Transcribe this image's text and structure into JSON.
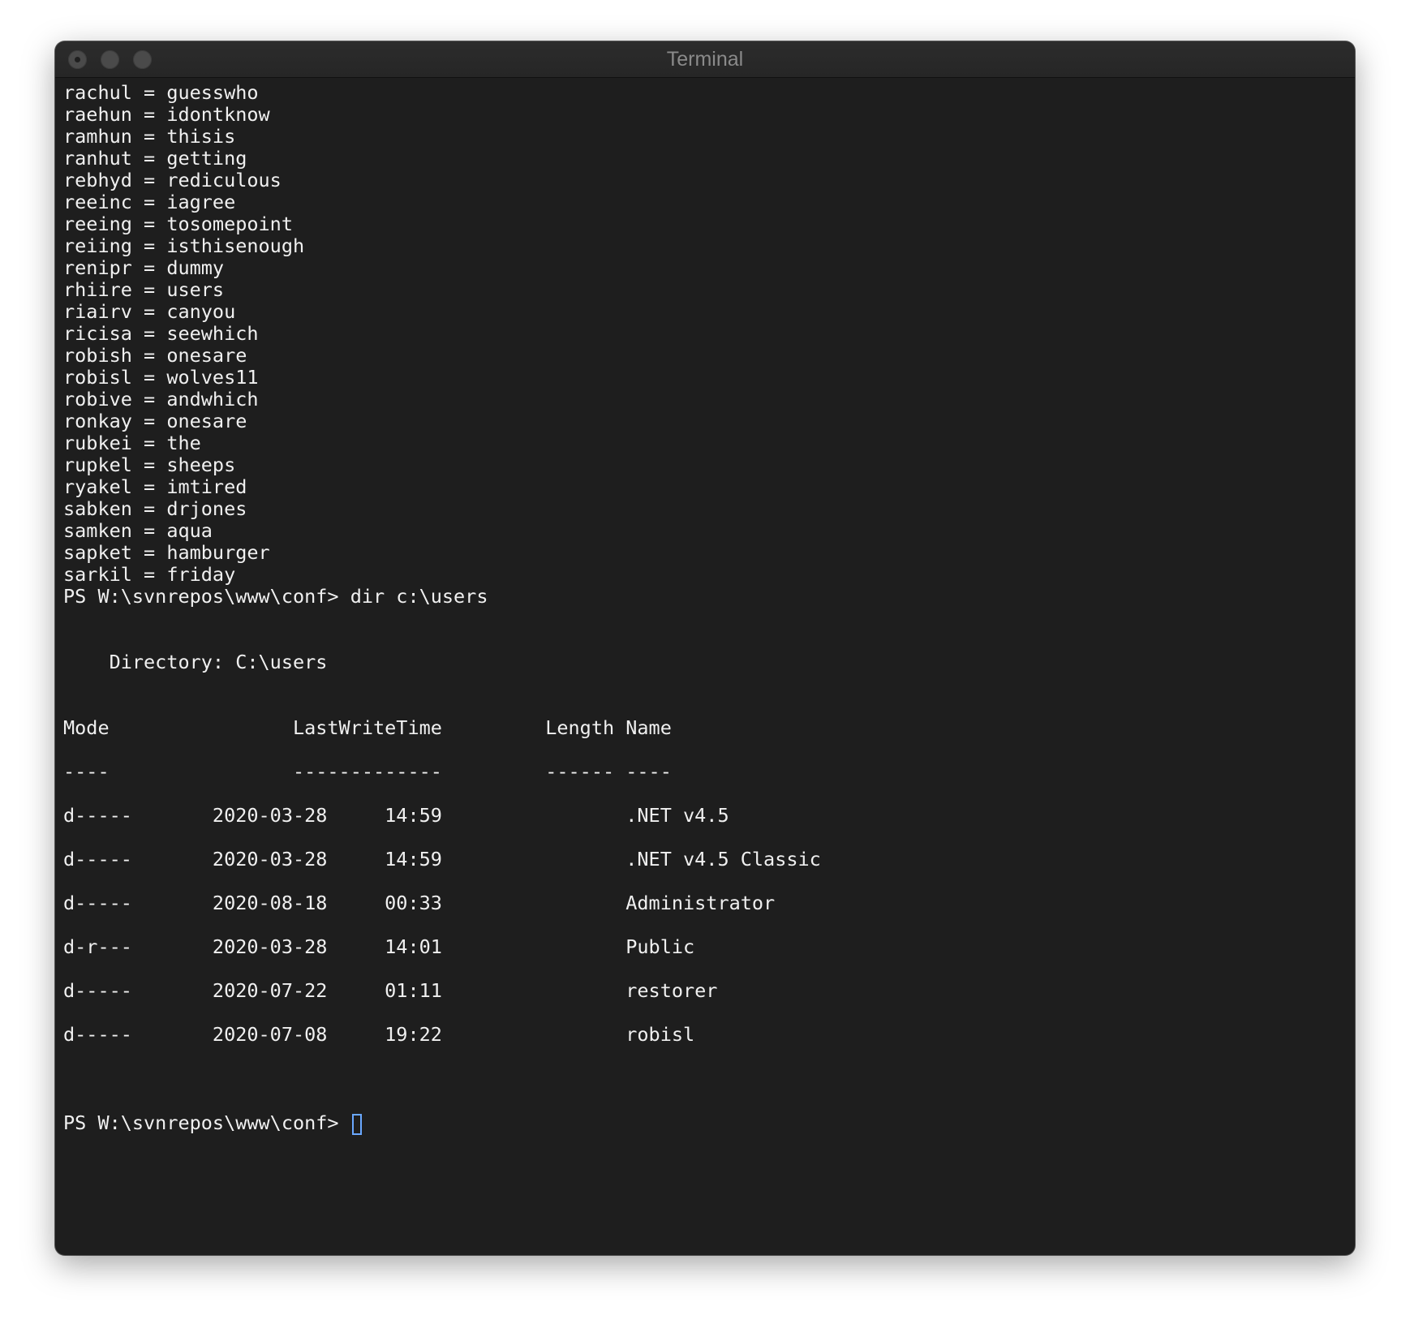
{
  "window": {
    "title": "Terminal"
  },
  "terminal": {
    "config_lines": [
      "rachul = guesswho",
      "raehun = idontknow",
      "ramhun = thisis",
      "ranhut = getting",
      "rebhyd = rediculous",
      "reeinc = iagree",
      "reeing = tosomepoint",
      "reiing = isthisenough",
      "renipr = dummy",
      "rhiire = users",
      "riairv = canyou",
      "ricisa = seewhich",
      "robish = onesare",
      "robisl = wolves11",
      "robive = andwhich",
      "ronkay = onesare",
      "rubkei = the",
      "rupkel = sheeps",
      "ryakel = imtired",
      "sabken = drjones",
      "samken = aqua",
      "sapket = hamburger",
      "sarkil = friday"
    ],
    "command_line": "PS W:\\svnrepos\\www\\conf> dir c:\\users",
    "directory_line": "    Directory: C:\\users",
    "header_line": "Mode                LastWriteTime         Length Name",
    "separator_line": "----                -------------         ------ ----",
    "listing": [
      "d-----       2020-03-28     14:59                .NET v4.5",
      "d-----       2020-03-28     14:59                .NET v4.5 Classic",
      "d-----       2020-08-18     00:33                Administrator",
      "d-r---       2020-03-28     14:01                Public",
      "d-----       2020-07-22     01:11                restorer",
      "d-----       2020-07-08     19:22                robisl"
    ],
    "prompt": "PS W:\\svnrepos\\www\\conf> "
  },
  "colors": {
    "background": "#1e1e1e",
    "text": "#f0f0f0",
    "cursor": "#6aa8ff"
  }
}
